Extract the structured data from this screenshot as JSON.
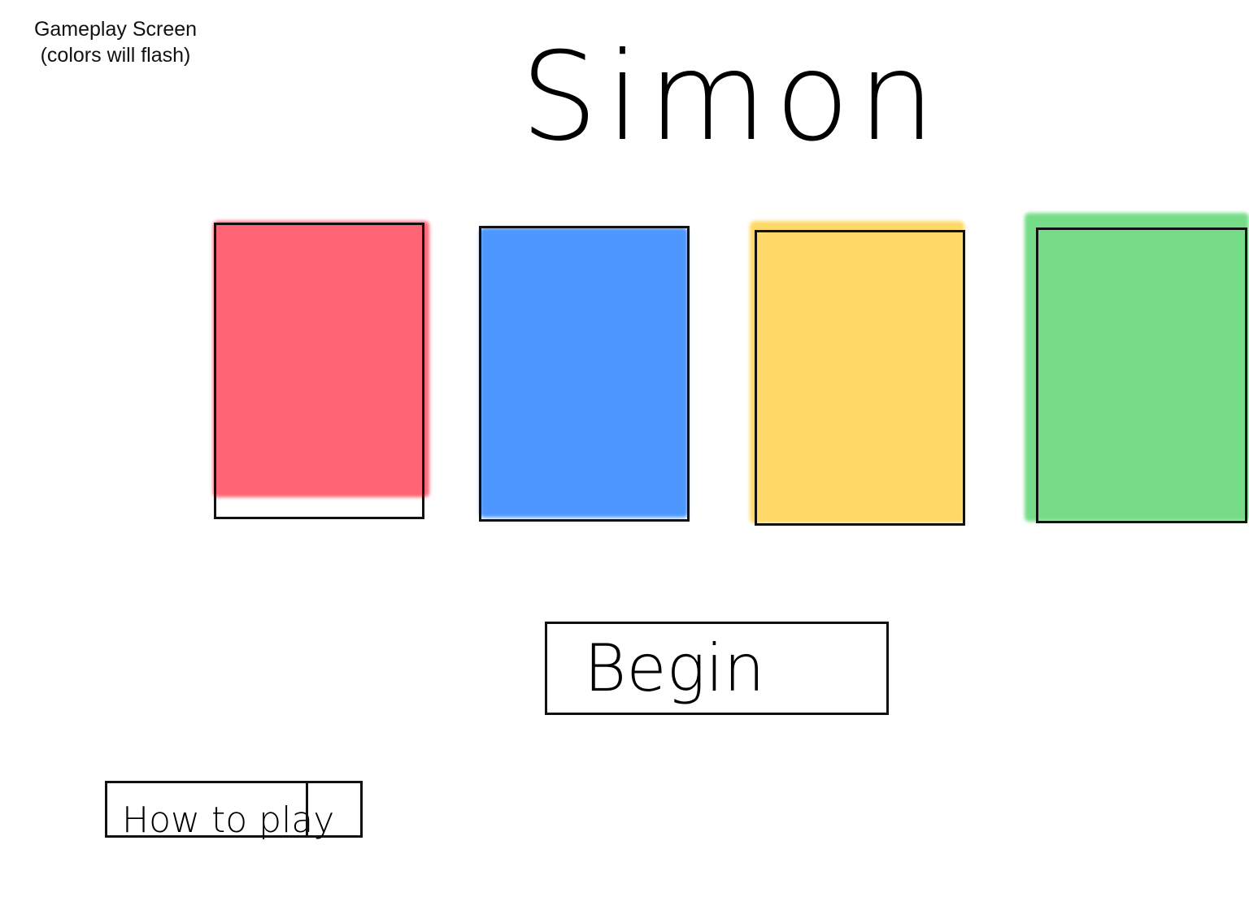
{
  "annotation": {
    "line1": "Gameplay Screen",
    "line2": "(colors will flash)"
  },
  "title": "Simon",
  "pads": [
    {
      "name": "red",
      "color": "#ff4a5c"
    },
    {
      "name": "blue",
      "color": "#2f86ff"
    },
    {
      "name": "yellow",
      "color": "#ffd34d"
    },
    {
      "name": "green",
      "color": "#5fd774"
    }
  ],
  "buttons": {
    "begin": "Begin",
    "how_to_play": "How to play"
  }
}
